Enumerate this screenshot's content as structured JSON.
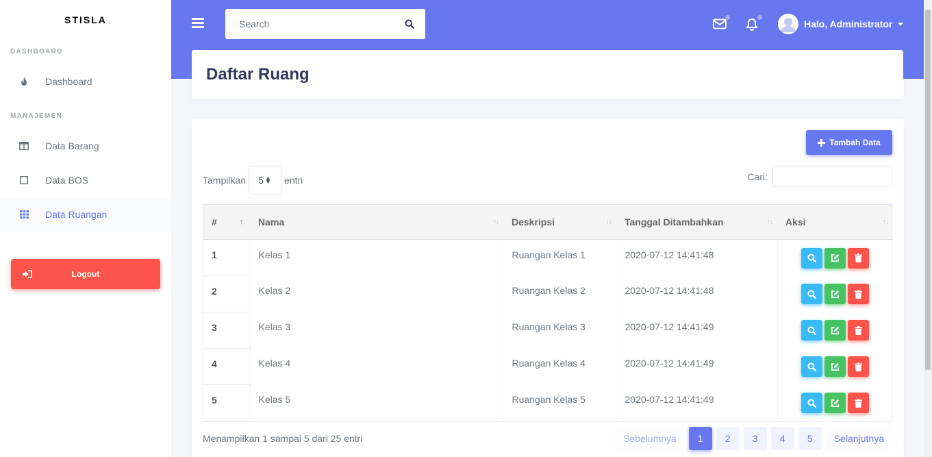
{
  "brand": "STISLA",
  "sidebar": {
    "sections": [
      {
        "header": "DASHBOARD",
        "items": [
          {
            "label": "Dashboard",
            "icon": "fire-icon"
          }
        ]
      },
      {
        "header": "MANAJEMEN",
        "items": [
          {
            "label": "Data Barang",
            "icon": "columns-icon"
          },
          {
            "label": "Data BOS",
            "icon": "square-icon"
          },
          {
            "label": "Data Ruangan",
            "icon": "grid-icon",
            "active": true
          }
        ]
      }
    ],
    "logout_label": "Logout"
  },
  "navbar": {
    "search_placeholder": "Search",
    "user_label": "Halo, Administrator"
  },
  "page": {
    "title": "Daftar Ruang"
  },
  "card": {
    "add_button": "Tambah Data",
    "length_prefix": "Tampilkan",
    "length_value": "5",
    "length_suffix": "entri",
    "filter_label": "Cari:"
  },
  "table": {
    "columns": [
      "#",
      "Nama",
      "Deskripsi",
      "Tanggal Ditambahkan",
      "Aksi"
    ],
    "rows": [
      {
        "no": "1",
        "nama": "Kelas 1",
        "deskripsi": "Ruangan Kelas 1",
        "tanggal": "2020-07-12 14:41:48"
      },
      {
        "no": "2",
        "nama": "Kelas 2",
        "deskripsi": "Ruangan Kelas 2",
        "tanggal": "2020-07-12 14:41:48"
      },
      {
        "no": "3",
        "nama": "Kelas 3",
        "deskripsi": "Ruangan Kelas 3",
        "tanggal": "2020-07-12 14:41:49"
      },
      {
        "no": "4",
        "nama": "Kelas 4",
        "deskripsi": "Ruangan Kelas 4",
        "tanggal": "2020-07-12 14:41:49"
      },
      {
        "no": "5",
        "nama": "Kelas 5",
        "deskripsi": "Ruangan Kelas 5",
        "tanggal": "2020-07-12 14:41:49"
      }
    ]
  },
  "footer": {
    "info": "Menampilkan 1 sampai 5 dari 25 entri",
    "prev": "Sebelumnya",
    "next": "Selanjutnya",
    "pages": [
      "1",
      "2",
      "3",
      "4",
      "5"
    ],
    "active_page": "1"
  },
  "colors": {
    "primary": "#6777ef",
    "info": "#3abaf4",
    "success": "#47c363",
    "danger": "#fc544b"
  }
}
